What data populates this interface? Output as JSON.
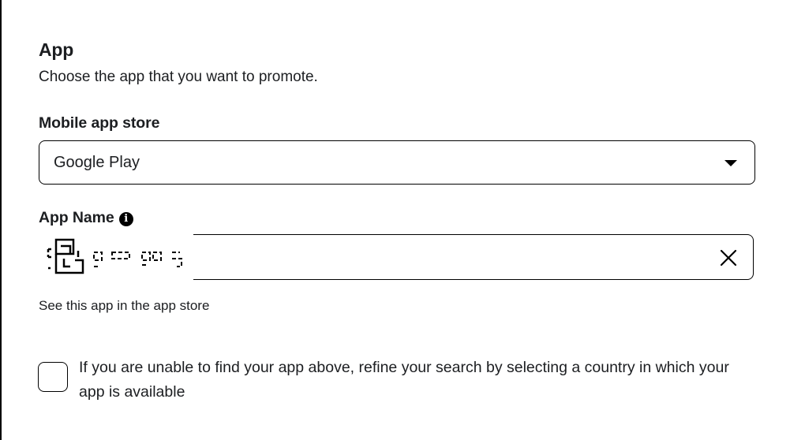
{
  "section": {
    "title": "App",
    "description": "Choose the app that you want to promote."
  },
  "store_field": {
    "label": "Mobile app store",
    "selected_value": "Google Play",
    "caret_icon": "caret-down-icon"
  },
  "app_name_field": {
    "label": "App Name",
    "info_icon": "info-icon",
    "info_glyph": "i",
    "clear_icon": "close-icon"
  },
  "store_link": {
    "label": "See this app in the app store"
  },
  "country_option": {
    "checked": false,
    "label": "If you are unable to find your app above, refine your search by selecting a country in which your app is available"
  },
  "colors": {
    "text": "#1c1e21",
    "border": "#000000",
    "background": "#ffffff"
  }
}
